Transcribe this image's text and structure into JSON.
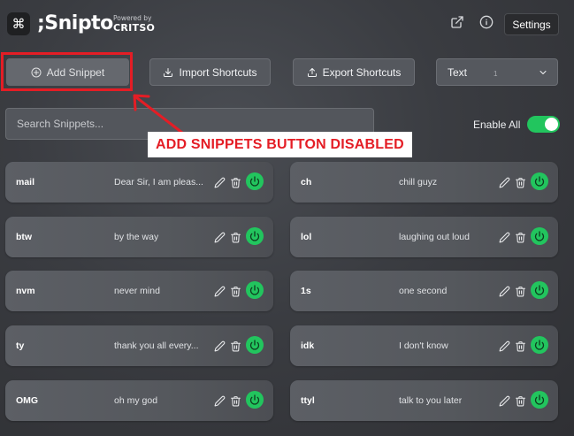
{
  "header": {
    "logo_glyph": "⌘",
    "brand": ";Snipto",
    "powered_by": "Powered by",
    "company": "CRITSO",
    "icons": [
      "external-link-icon",
      "info-icon"
    ],
    "settings_label": "Settings"
  },
  "toolbar": {
    "add_label": "Add Snippet",
    "add_disabled": true,
    "import_label": "Import Shortcuts",
    "export_label": "Export Shortcuts",
    "type_select": {
      "selected": "Text",
      "count": "1"
    }
  },
  "search": {
    "placeholder": "Search Snippets..."
  },
  "enable_all": {
    "label": "Enable All",
    "on": true
  },
  "annotation": {
    "text": "ADD SNIPPETS BUTTON DISABLED",
    "color": "#e41d25"
  },
  "snippets": [
    {
      "shortcut": "mail",
      "text": "Dear Sir, I am pleas...",
      "enabled": true
    },
    {
      "shortcut": "ch",
      "text": "chill guyz",
      "enabled": true
    },
    {
      "shortcut": "btw",
      "text": "by the way",
      "enabled": true
    },
    {
      "shortcut": "lol",
      "text": "laughing out loud",
      "enabled": true
    },
    {
      "shortcut": "nvm",
      "text": "never mind",
      "enabled": true
    },
    {
      "shortcut": "1s",
      "text": "one second",
      "enabled": true
    },
    {
      "shortcut": "ty",
      "text": "thank you all every...",
      "enabled": true
    },
    {
      "shortcut": "idk",
      "text": "I don't know",
      "enabled": true
    },
    {
      "shortcut": "OMG",
      "text": "oh my god",
      "enabled": true
    },
    {
      "shortcut": "ttyl",
      "text": "talk to you later",
      "enabled": true
    }
  ],
  "colors": {
    "accent_green": "#22c55e",
    "background": "#3a3c41",
    "card": "#5c5f65"
  }
}
